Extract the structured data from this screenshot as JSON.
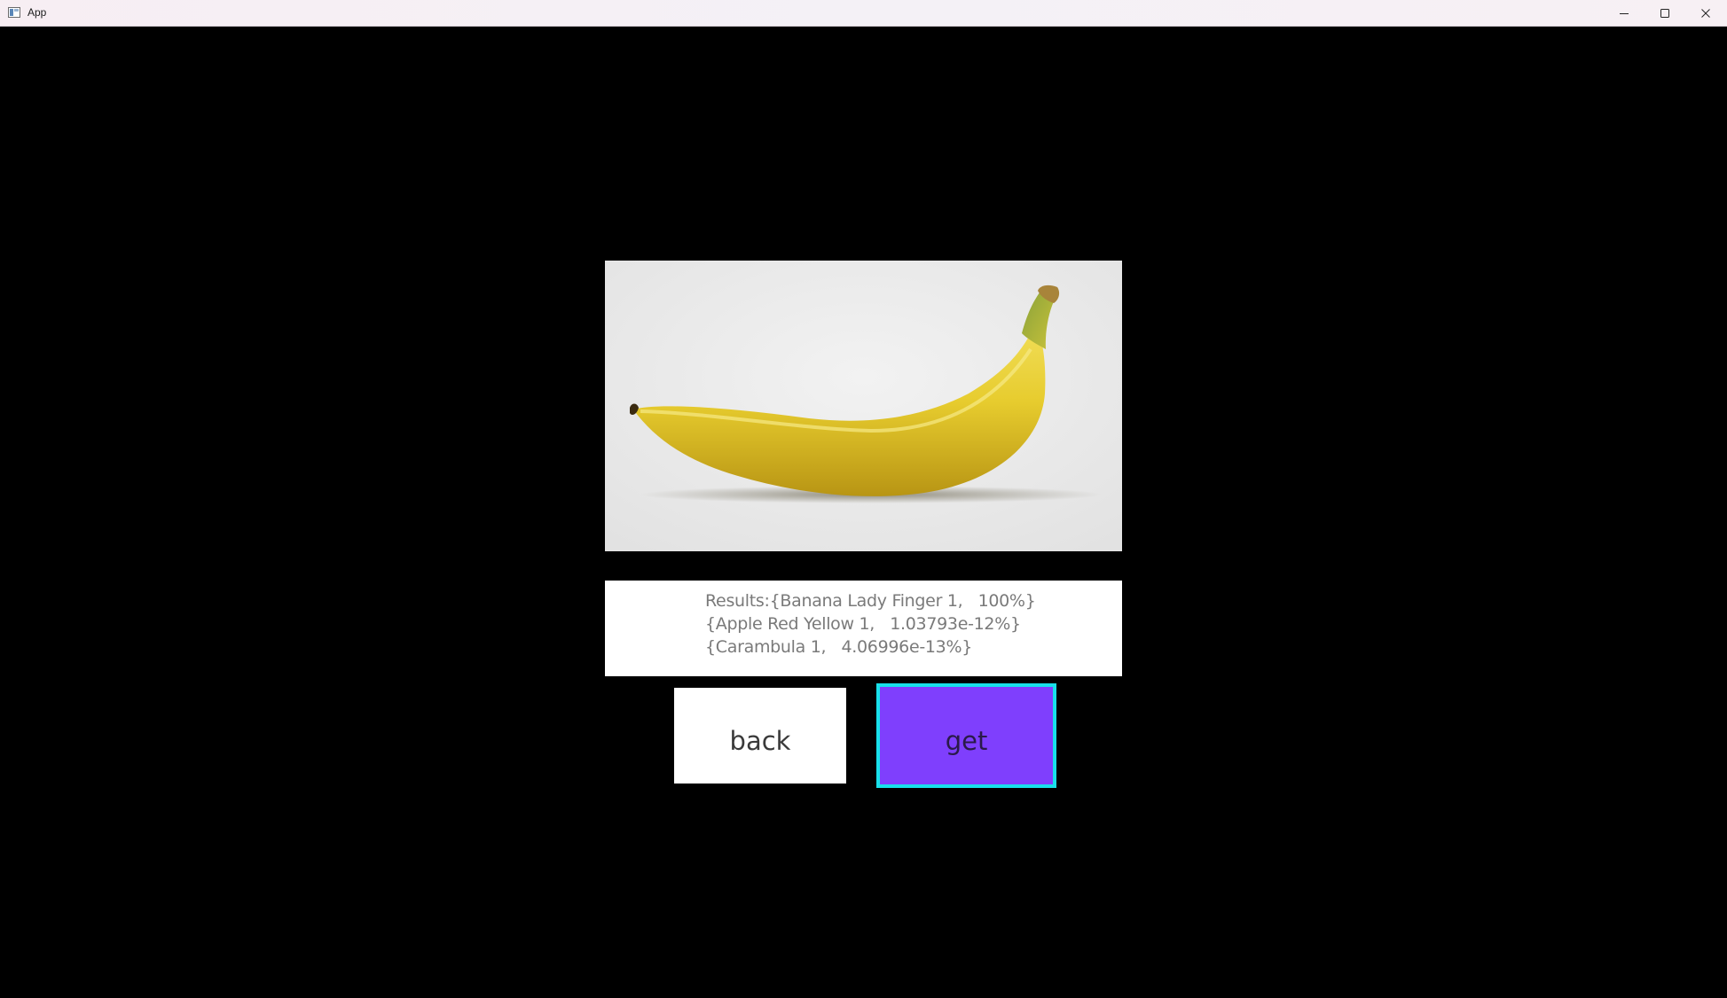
{
  "window": {
    "title": "App",
    "controls": {
      "minimize": "minimize-icon",
      "maximize": "maximize-icon",
      "close": "close-icon"
    }
  },
  "image": {
    "subject": "banana",
    "background_color": "#e9e9e9"
  },
  "results": {
    "line1": "Results:{Banana Lady Finger 1,   100%}",
    "line2": "{Apple Red Yellow 1,   1.03793e-12%}",
    "line3": "{Carambula 1,   4.06996e-13%}"
  },
  "buttons": {
    "back_label": "back",
    "get_label": "get"
  },
  "colors": {
    "background": "#000000",
    "get_button": "#7f3ffd",
    "get_button_focus_border": "#18e0ea",
    "back_button": "#ffffff",
    "result_text": "#7a7a7a"
  }
}
